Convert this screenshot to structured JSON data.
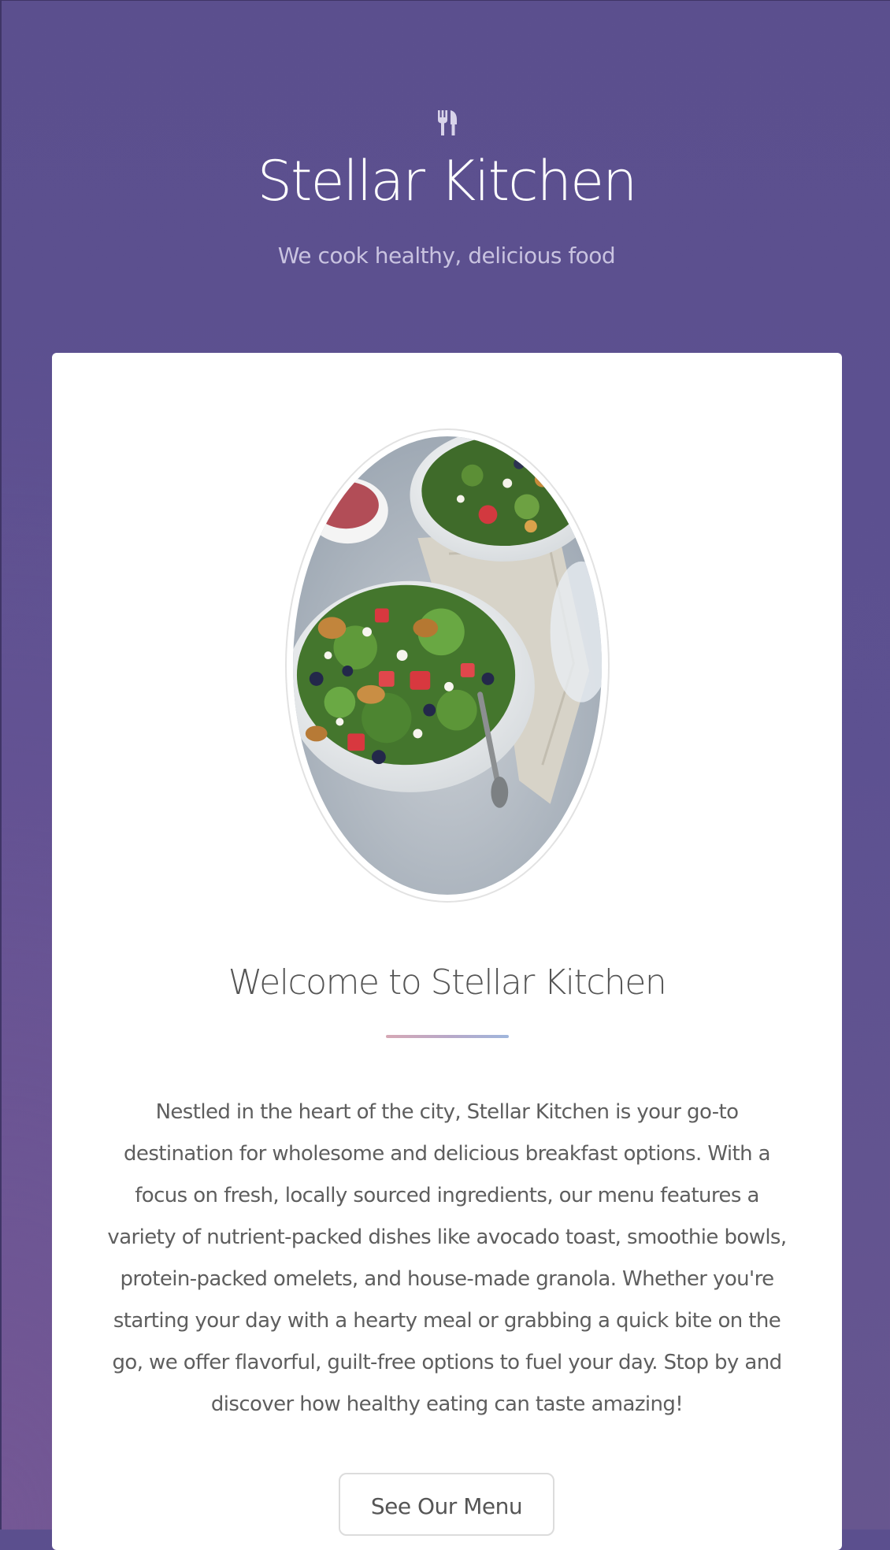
{
  "header": {
    "icon": "fork-knife-icon",
    "title": "Stellar Kitchen",
    "tagline": "We cook healthy, delicious food"
  },
  "main": {
    "hero_image": "salad-bowls-photo",
    "heading": "Welcome to Stellar Kitchen",
    "description": "Nestled in the heart of the city, Stellar Kitchen is your go-to destination for wholesome and delicious breakfast options. With a focus on fresh, locally sourced ingredients, our menu features a variety of nutrient-packed dishes like avocado toast, smoothie bowls, protein-packed omelets, and house-made granola. Whether you're starting your day with a hearty meal or grabbing a quick bite on the go, we offer flavorful, guilt-free options to fuel your day. Stop by and discover how healthy eating can taste amazing!",
    "cta_label": "See Our Menu"
  },
  "colors": {
    "background": "#5d5191",
    "card": "#ffffff",
    "text": "#5e5e5e",
    "divider_start": "#d6a8b5",
    "divider_end": "#9fb6dc"
  }
}
